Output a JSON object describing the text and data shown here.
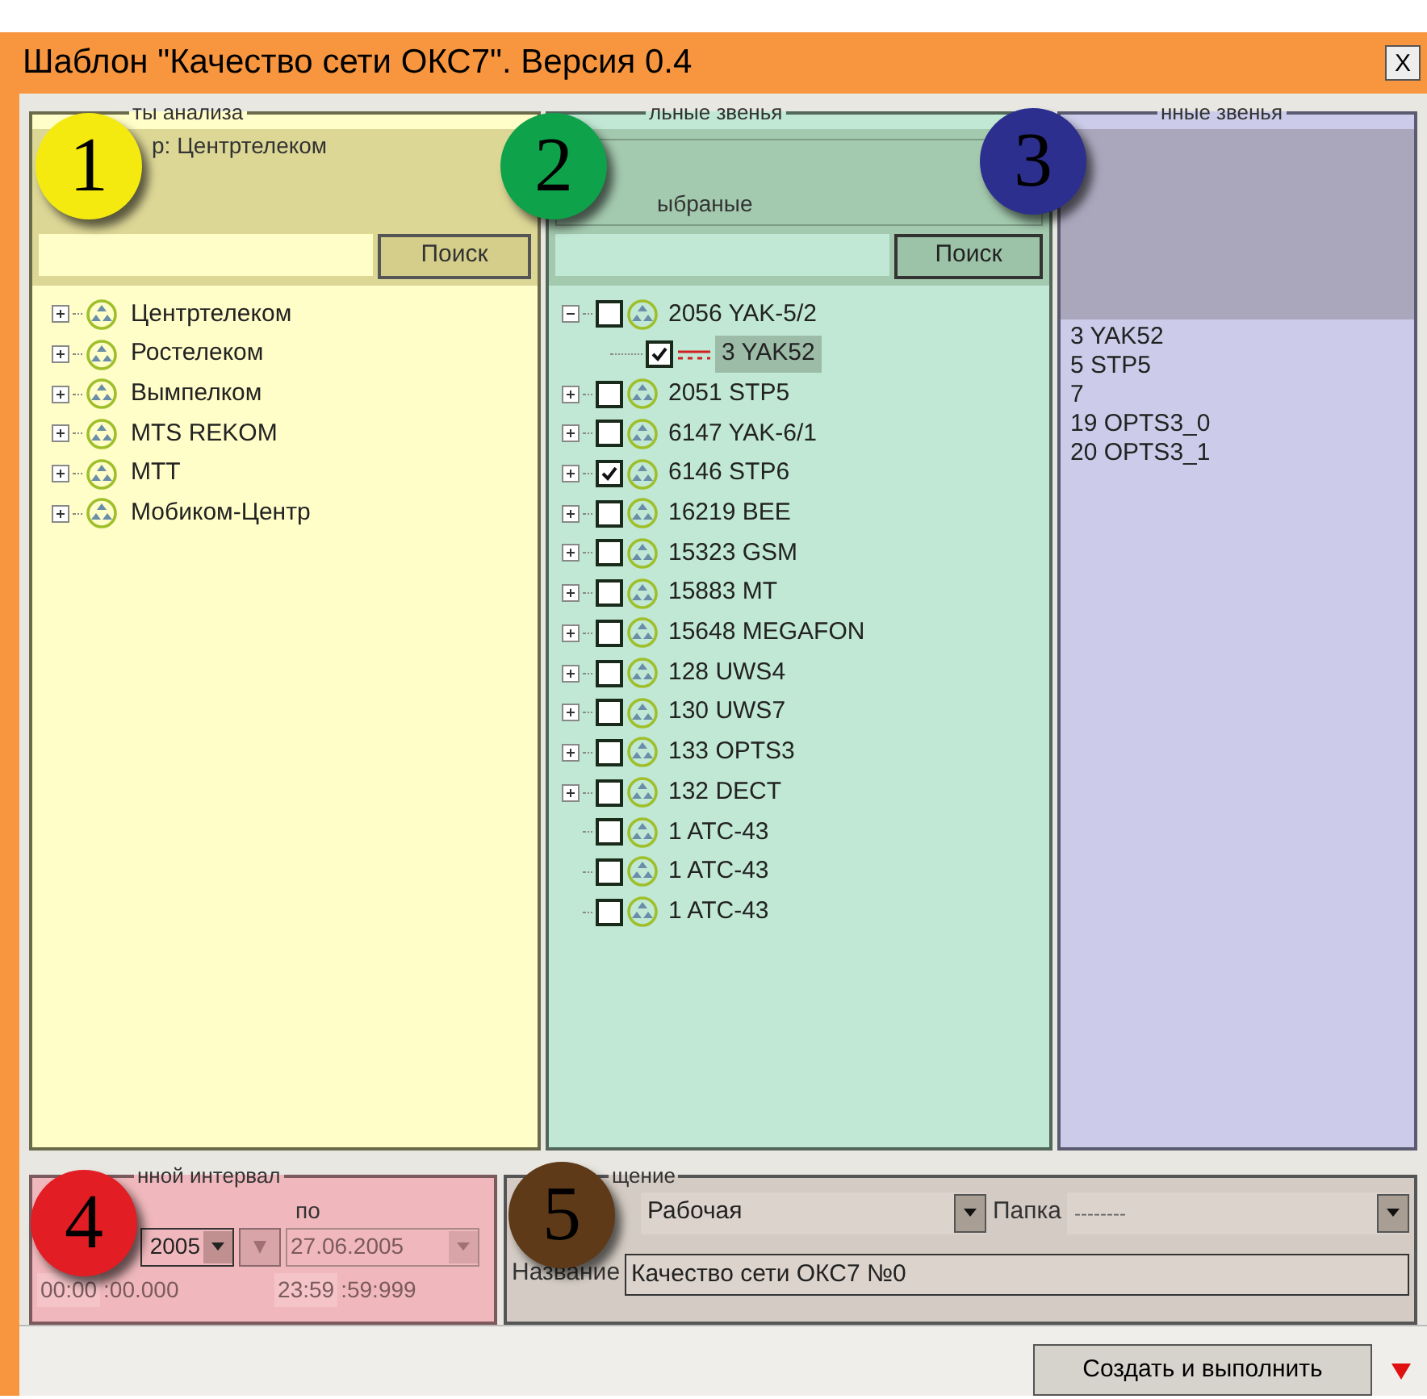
{
  "window": {
    "title": "Шаблон \"Качество сети ОКС7\". Версия 0.4",
    "close": "X"
  },
  "panel_1": {
    "legend": "ты анализа",
    "filter": "р: Центртелеком",
    "search_button": "Поиск",
    "tree": [
      {
        "label": "Центртелеком",
        "expanded": false
      },
      {
        "label": "Ростелеком",
        "expanded": false
      },
      {
        "label": "Вымпелком",
        "expanded": false
      },
      {
        "label": "MTS REKOM",
        "expanded": false
      },
      {
        "label": "MTT",
        "expanded": false
      },
      {
        "label": "Мобиком-Центр",
        "expanded": false
      }
    ]
  },
  "panel_2": {
    "legend": "льные звенья",
    "option": "ыбраные",
    "search_button": "Поиск",
    "tree": [
      {
        "label": "2056 YAK-5/2",
        "checked": false,
        "expanded": true,
        "children": [
          {
            "label": "3 YAK52",
            "checked": true,
            "selected": true
          }
        ]
      },
      {
        "label": "2051 STP5",
        "checked": false,
        "expanded": false
      },
      {
        "label": "6147 YAK-6/1",
        "checked": false,
        "expanded": false
      },
      {
        "label": "6146 STP6",
        "checked": true,
        "expanded": false
      },
      {
        "label": "16219 BEE",
        "checked": false,
        "expanded": false
      },
      {
        "label": "15323 GSM",
        "checked": false,
        "expanded": false
      },
      {
        "label": "15883 MT",
        "checked": false,
        "expanded": false
      },
      {
        "label": "15648 MEGAFON",
        "checked": false,
        "expanded": false
      },
      {
        "label": "128 UWS4",
        "checked": false,
        "expanded": false
      },
      {
        "label": "130 UWS7",
        "checked": false,
        "expanded": false
      },
      {
        "label": "133 OPTS3",
        "checked": false,
        "expanded": false
      },
      {
        "label": "132 DECT",
        "checked": false,
        "expanded": false
      },
      {
        "label": "1 ATC-43",
        "checked": false
      },
      {
        "label": "1 ATC-43",
        "checked": false
      },
      {
        "label": "1 ATC-43",
        "checked": false
      }
    ]
  },
  "panel_3": {
    "legend": "нные звенья",
    "items": [
      "3 YAK52",
      "5 STP5",
      "7",
      "19 OPTS3_0",
      "20 OPTS3_1"
    ]
  },
  "interval": {
    "legend": "нной интервал",
    "to_label": "по",
    "from_date": "2005",
    "to_date": "27.06.2005",
    "from_time": "00:00",
    "from_seconds": ":00.000",
    "to_time": "23:59",
    "to_seconds": ":59:999"
  },
  "placement": {
    "legend": "щение",
    "location": "Рабочая",
    "folder_label": "Папка",
    "folder": "--------",
    "name_label": "Название",
    "name": "Качество сети ОКС7 №0"
  },
  "footer": {
    "button": "Создать и выполнить"
  },
  "badges": [
    {
      "text": "1",
      "color": "#f5ea10"
    },
    {
      "text": "2",
      "color": "#0ea24a"
    },
    {
      "text": "3",
      "color": "#2d2f8f"
    },
    {
      "text": "4",
      "color": "#e21d24"
    },
    {
      "text": "5",
      "color": "#5e3a18"
    }
  ]
}
